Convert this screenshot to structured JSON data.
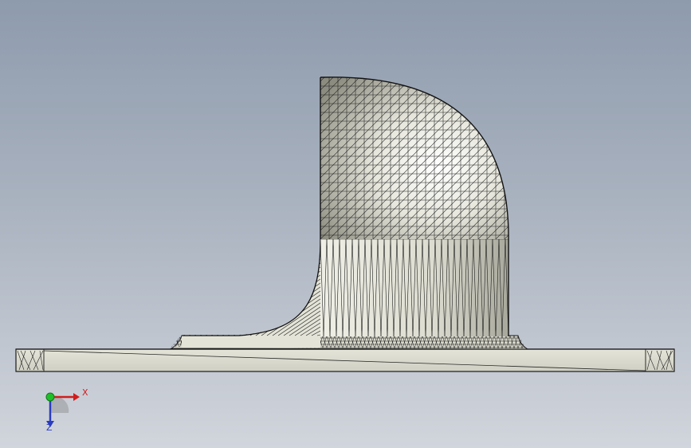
{
  "viewport": {
    "background_top": "#8e9bad",
    "background_bottom": "#d1d5dc"
  },
  "model": {
    "face_color": "#ddddd1",
    "edge_color": "#1a1a1a"
  },
  "triad": {
    "x_label": "X",
    "z_label": "Z",
    "x_color": "#d11d1d",
    "y_color": "#1fbf2a",
    "z_color": "#2a3dbf"
  }
}
